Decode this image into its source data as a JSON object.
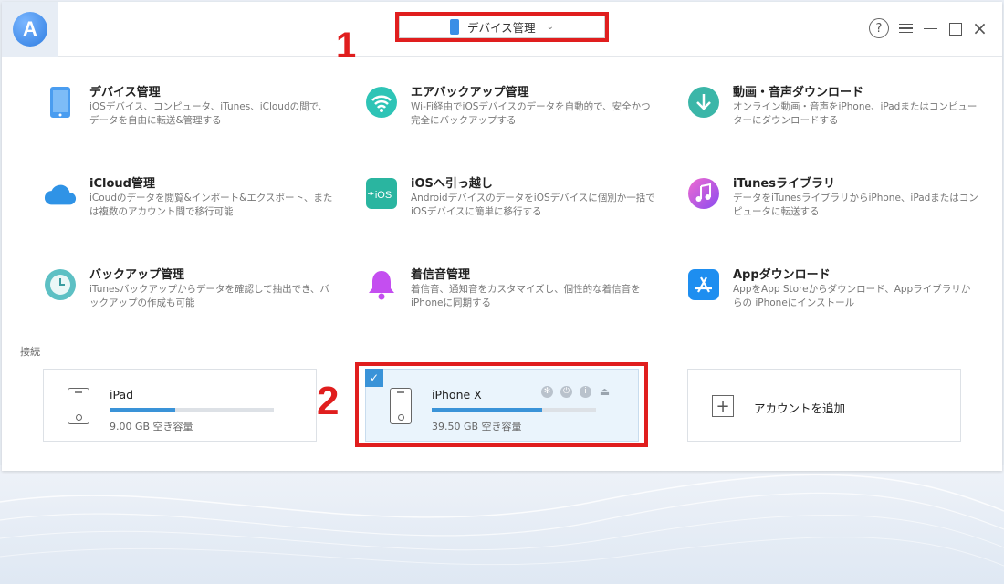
{
  "header": {
    "device_selector_label": "デバイス管理",
    "annotation_1": "1",
    "annotation_2": "2"
  },
  "window_controls": {
    "help": "?",
    "close": "×"
  },
  "features": [
    {
      "title": "デバイス管理",
      "desc": "iOSデバイス、コンピュータ、iTunes、iCloudの間で、データを自由に転送&管理する",
      "icon": "phone-icon"
    },
    {
      "title": "エアバックアップ管理",
      "desc": "Wi-Fi経由でiOSデバイスのデータを自動的で、安全かつ完全にバックアップする",
      "icon": "wifi-backup-icon"
    },
    {
      "title": "動画・音声ダウンロード",
      "desc": "オンライン動画・音声をiPhone、iPadまたはコンピューターにダウンロードする",
      "icon": "download-icon"
    },
    {
      "title": "iCloud管理",
      "desc": "iCoudのデータを閲覧&インポート&エクスポート、または複数のアカウント間で移行可能",
      "icon": "cloud-icon"
    },
    {
      "title": "iOSへ引っ越し",
      "desc": "AndroidデバイスのデータをiOSデバイスに個別か一括でiOSデバイスに簡単に移行する",
      "icon": "ios-transfer-icon",
      "icon_text": "iOS"
    },
    {
      "title": "iTunesライブラリ",
      "desc": "データをiTunesライブラリからiPhone、iPadまたはコンピュータに転送する",
      "icon": "music-icon"
    },
    {
      "title": "バックアップ管理",
      "desc": "iTunesバックアップからデータを確認して抽出でき、バックアップの作成も可能",
      "icon": "backup-clock-icon"
    },
    {
      "title": "着信音管理",
      "desc": "着信音、通知音をカスタマイズし、個性的な着信音をiPhoneに同期する",
      "icon": "bell-icon"
    },
    {
      "title": "Appダウンロード",
      "desc": "AppをApp Storeからダウンロード、Appライブラリからの iPhoneにインストール",
      "icon": "app-store-icon"
    }
  ],
  "connection": {
    "section_label": "接続",
    "devices": [
      {
        "name": "iPad",
        "capacity": "9.00 GB 空き容量",
        "usage": 0.4,
        "selected": false
      },
      {
        "name": "iPhone X",
        "capacity": "39.50 GB 空き容量",
        "usage": 0.67,
        "selected": true
      }
    ],
    "add_account_label": "アカウントを追加",
    "add_symbol": "+"
  },
  "colors": {
    "accent": "#3a93d8",
    "annotation_red": "#e01e1e"
  }
}
